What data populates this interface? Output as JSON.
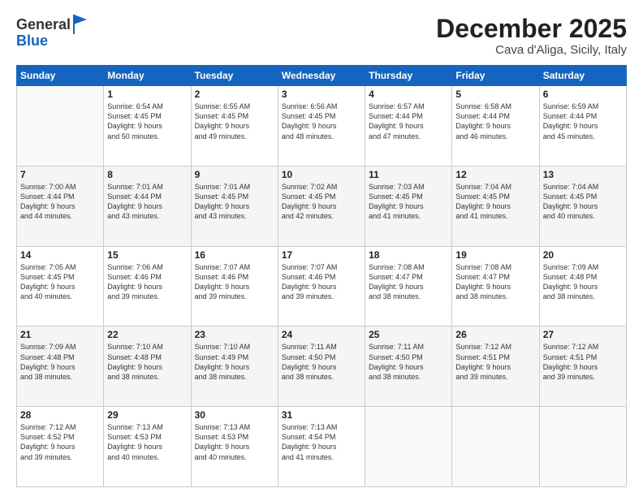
{
  "header": {
    "logo_line1": "General",
    "logo_line2": "Blue",
    "month": "December 2025",
    "location": "Cava d'Aliga, Sicily, Italy"
  },
  "days_of_week": [
    "Sunday",
    "Monday",
    "Tuesday",
    "Wednesday",
    "Thursday",
    "Friday",
    "Saturday"
  ],
  "weeks": [
    [
      {
        "day": "",
        "info": ""
      },
      {
        "day": "1",
        "info": "Sunrise: 6:54 AM\nSunset: 4:45 PM\nDaylight: 9 hours\nand 50 minutes."
      },
      {
        "day": "2",
        "info": "Sunrise: 6:55 AM\nSunset: 4:45 PM\nDaylight: 9 hours\nand 49 minutes."
      },
      {
        "day": "3",
        "info": "Sunrise: 6:56 AM\nSunset: 4:45 PM\nDaylight: 9 hours\nand 48 minutes."
      },
      {
        "day": "4",
        "info": "Sunrise: 6:57 AM\nSunset: 4:44 PM\nDaylight: 9 hours\nand 47 minutes."
      },
      {
        "day": "5",
        "info": "Sunrise: 6:58 AM\nSunset: 4:44 PM\nDaylight: 9 hours\nand 46 minutes."
      },
      {
        "day": "6",
        "info": "Sunrise: 6:59 AM\nSunset: 4:44 PM\nDaylight: 9 hours\nand 45 minutes."
      }
    ],
    [
      {
        "day": "7",
        "info": "Sunrise: 7:00 AM\nSunset: 4:44 PM\nDaylight: 9 hours\nand 44 minutes."
      },
      {
        "day": "8",
        "info": "Sunrise: 7:01 AM\nSunset: 4:44 PM\nDaylight: 9 hours\nand 43 minutes."
      },
      {
        "day": "9",
        "info": "Sunrise: 7:01 AM\nSunset: 4:45 PM\nDaylight: 9 hours\nand 43 minutes."
      },
      {
        "day": "10",
        "info": "Sunrise: 7:02 AM\nSunset: 4:45 PM\nDaylight: 9 hours\nand 42 minutes."
      },
      {
        "day": "11",
        "info": "Sunrise: 7:03 AM\nSunset: 4:45 PM\nDaylight: 9 hours\nand 41 minutes."
      },
      {
        "day": "12",
        "info": "Sunrise: 7:04 AM\nSunset: 4:45 PM\nDaylight: 9 hours\nand 41 minutes."
      },
      {
        "day": "13",
        "info": "Sunrise: 7:04 AM\nSunset: 4:45 PM\nDaylight: 9 hours\nand 40 minutes."
      }
    ],
    [
      {
        "day": "14",
        "info": "Sunrise: 7:05 AM\nSunset: 4:45 PM\nDaylight: 9 hours\nand 40 minutes."
      },
      {
        "day": "15",
        "info": "Sunrise: 7:06 AM\nSunset: 4:46 PM\nDaylight: 9 hours\nand 39 minutes."
      },
      {
        "day": "16",
        "info": "Sunrise: 7:07 AM\nSunset: 4:46 PM\nDaylight: 9 hours\nand 39 minutes."
      },
      {
        "day": "17",
        "info": "Sunrise: 7:07 AM\nSunset: 4:46 PM\nDaylight: 9 hours\nand 39 minutes."
      },
      {
        "day": "18",
        "info": "Sunrise: 7:08 AM\nSunset: 4:47 PM\nDaylight: 9 hours\nand 38 minutes."
      },
      {
        "day": "19",
        "info": "Sunrise: 7:08 AM\nSunset: 4:47 PM\nDaylight: 9 hours\nand 38 minutes."
      },
      {
        "day": "20",
        "info": "Sunrise: 7:09 AM\nSunset: 4:48 PM\nDaylight: 9 hours\nand 38 minutes."
      }
    ],
    [
      {
        "day": "21",
        "info": "Sunrise: 7:09 AM\nSunset: 4:48 PM\nDaylight: 9 hours\nand 38 minutes."
      },
      {
        "day": "22",
        "info": "Sunrise: 7:10 AM\nSunset: 4:48 PM\nDaylight: 9 hours\nand 38 minutes."
      },
      {
        "day": "23",
        "info": "Sunrise: 7:10 AM\nSunset: 4:49 PM\nDaylight: 9 hours\nand 38 minutes."
      },
      {
        "day": "24",
        "info": "Sunrise: 7:11 AM\nSunset: 4:50 PM\nDaylight: 9 hours\nand 38 minutes."
      },
      {
        "day": "25",
        "info": "Sunrise: 7:11 AM\nSunset: 4:50 PM\nDaylight: 9 hours\nand 38 minutes."
      },
      {
        "day": "26",
        "info": "Sunrise: 7:12 AM\nSunset: 4:51 PM\nDaylight: 9 hours\nand 39 minutes."
      },
      {
        "day": "27",
        "info": "Sunrise: 7:12 AM\nSunset: 4:51 PM\nDaylight: 9 hours\nand 39 minutes."
      }
    ],
    [
      {
        "day": "28",
        "info": "Sunrise: 7:12 AM\nSunset: 4:52 PM\nDaylight: 9 hours\nand 39 minutes."
      },
      {
        "day": "29",
        "info": "Sunrise: 7:13 AM\nSunset: 4:53 PM\nDaylight: 9 hours\nand 40 minutes."
      },
      {
        "day": "30",
        "info": "Sunrise: 7:13 AM\nSunset: 4:53 PM\nDaylight: 9 hours\nand 40 minutes."
      },
      {
        "day": "31",
        "info": "Sunrise: 7:13 AM\nSunset: 4:54 PM\nDaylight: 9 hours\nand 41 minutes."
      },
      {
        "day": "",
        "info": ""
      },
      {
        "day": "",
        "info": ""
      },
      {
        "day": "",
        "info": ""
      }
    ]
  ]
}
